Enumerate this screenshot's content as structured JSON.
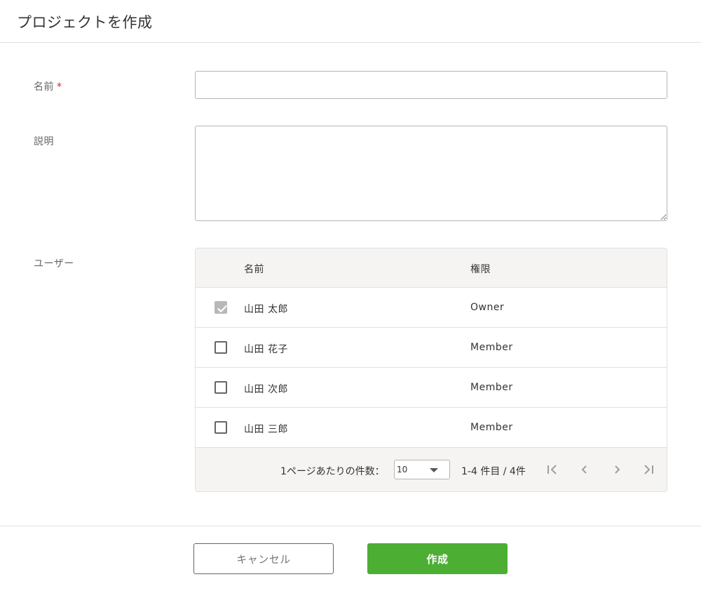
{
  "dialog": {
    "title": "プロジェクトを作成"
  },
  "form": {
    "name_label": "名前",
    "required_mark": "*",
    "name_value": "",
    "description_label": "説明",
    "description_value": "",
    "users_label": "ユーザー"
  },
  "users_table": {
    "columns": {
      "name": "名前",
      "role": "権限"
    },
    "rows": [
      {
        "name": "山田 太郎",
        "role": "Owner",
        "checked": true,
        "disabled": true
      },
      {
        "name": "山田 花子",
        "role": "Member",
        "checked": false,
        "disabled": false
      },
      {
        "name": "山田 次郎",
        "role": "Member",
        "checked": false,
        "disabled": false
      },
      {
        "name": "山田 三郎",
        "role": "Member",
        "checked": false,
        "disabled": false
      }
    ],
    "pagination": {
      "per_page_label": "1ページあたりの件数：",
      "per_page_value": "10",
      "range_text": "1-4 件目 / 4件",
      "icons": [
        "first-page-icon",
        "prev-page-icon",
        "next-page-icon",
        "last-page-icon"
      ]
    }
  },
  "actions": {
    "cancel_label": "キャンセル",
    "create_label": "作成"
  },
  "colors": {
    "primary": "#4cae32",
    "required": "#e02020",
    "table_header_bg": "#f5f4f3",
    "checkbox_disabled": "#b8b8b8"
  }
}
